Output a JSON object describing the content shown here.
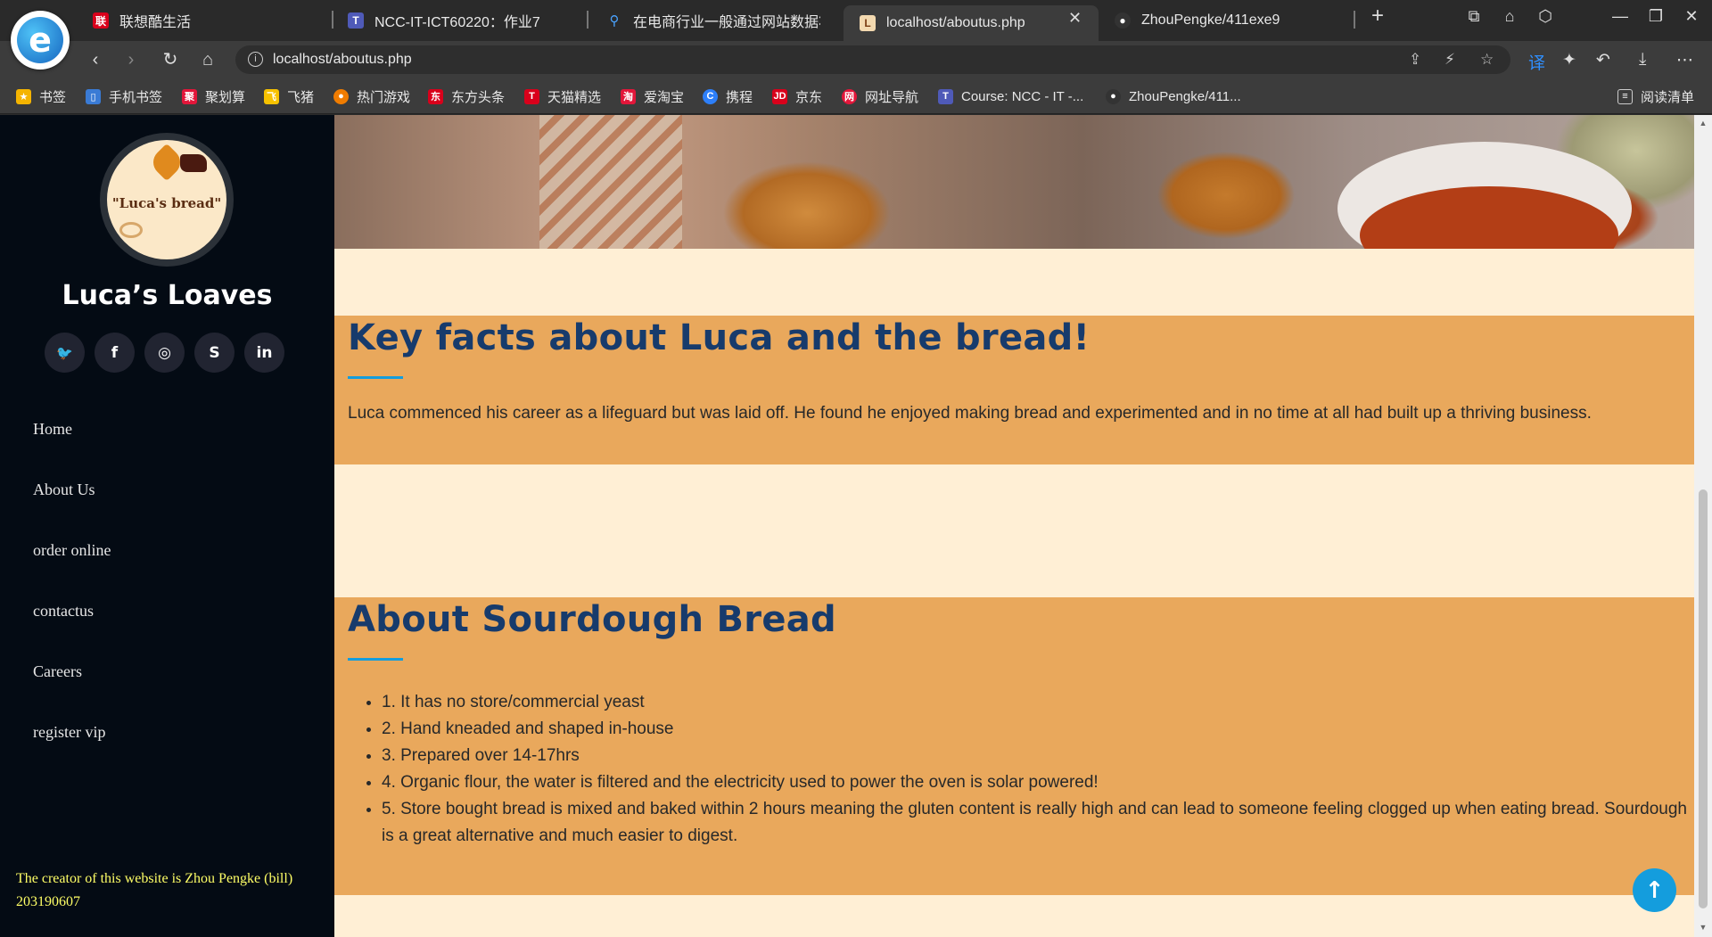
{
  "browser": {
    "tabs": [
      {
        "label": "联想酷生活",
        "active": false
      },
      {
        "label": "NCC-IT-ICT60220：作业7",
        "active": false
      },
      {
        "label": "在电商行业一般通过网站数据将",
        "active": false
      },
      {
        "label": "localhost/aboutus.php",
        "active": true
      },
      {
        "label": "ZhouPengke/411exe9",
        "active": false
      }
    ],
    "url": "localhost/aboutus.php",
    "bookmarks": [
      {
        "label": "书签",
        "color": "#f5b400"
      },
      {
        "label": "手机书签",
        "color": "#3a7bd5"
      },
      {
        "label": "聚划算",
        "color": "#e3163a"
      },
      {
        "label": "飞猪",
        "color": "#f7c200"
      },
      {
        "label": "热门游戏",
        "color": "#f07c00"
      },
      {
        "label": "东方头条",
        "color": "#d9001b"
      },
      {
        "label": "天猫精选",
        "color": "#d9001b"
      },
      {
        "label": "爱淘宝",
        "color": "#e3163a"
      },
      {
        "label": "携程",
        "color": "#2d7ff9"
      },
      {
        "label": "京东",
        "color": "#d9001b"
      },
      {
        "label": "网址导航",
        "color": "#e3163a"
      },
      {
        "label": "Course: NCC - IT -...",
        "color": "#4f5ab8"
      },
      {
        "label": "ZhouPengke/411...",
        "color": "#333333"
      }
    ],
    "reading_list": "阅读清单"
  },
  "sidebar": {
    "logo_text": "\"Luca's bread\"",
    "site_title": "Luca’s Loaves",
    "socials": [
      {
        "icon": "twitter-icon",
        "glyph": "🐦"
      },
      {
        "icon": "facebook-icon",
        "glyph": "f"
      },
      {
        "icon": "instagram-icon",
        "glyph": "◎"
      },
      {
        "icon": "skype-icon",
        "glyph": "S"
      },
      {
        "icon": "linkedin-icon",
        "glyph": "in"
      }
    ],
    "menu": [
      "Home",
      "About Us",
      "order online",
      "contactus",
      "Careers",
      "register vip"
    ],
    "credit": "The creator of this website is Zhou Pengke (bill) 203190607"
  },
  "main": {
    "facts": {
      "title": "Key facts about Luca and the bread!",
      "text": "Luca commenced his career as a lifeguard but was laid off. He found he enjoyed making bread and experimented and in no time at all had built up a thriving business."
    },
    "sourdough": {
      "title": "About Sourdough Bread",
      "items": [
        "1. It has no store/commercial yeast",
        "2. Hand kneaded and shaped in-house",
        "3. Prepared over 14-17hrs",
        "4. Organic flour, the water is filtered and the electricity used to power the oven is solar powered!",
        "5. Store bought bread is mixed and baked within 2 hours meaning the gluten content is really high and can lead to someone feeling clogged up when eating bread. Sourdough is a great alternative and much easier to digest."
      ]
    }
  },
  "colors": {
    "sidebar_bg": "#040b14",
    "section_bg": "#e9a85c",
    "page_bg": "#ffefd5",
    "heading": "#173b6c",
    "accent": "#149ddd",
    "credit": "#ffff66"
  }
}
